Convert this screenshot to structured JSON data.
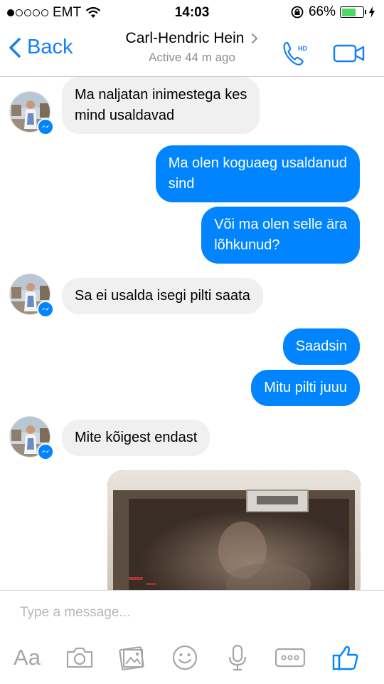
{
  "status_bar": {
    "signal_filled": 1,
    "signal_total": 5,
    "carrier": "EMT",
    "time": "14:03",
    "battery_percent": "66%",
    "battery_level": 0.66,
    "battery_color": "#4cd964"
  },
  "header": {
    "back_label": "Back",
    "contact_name": "Carl-Hendric Hein",
    "status": "Active 44 m ago",
    "icons": [
      "chevron-left-icon",
      "chevron-right-icon",
      "hd-phone-icon",
      "video-camera-icon"
    ]
  },
  "messages": [
    {
      "from": "contact",
      "text": "Ma naljatan inimestega kes\nmind usaldavad"
    },
    {
      "from": "me",
      "text": "Ma olen koguaeg usaldanud\nsind"
    },
    {
      "from": "me",
      "text": "Või ma olen selle ära\nlõhkunud?"
    },
    {
      "from": "contact",
      "text": "Sa ei usalda isegi pilti saata"
    },
    {
      "from": "me",
      "text": "Saadsin"
    },
    {
      "from": "me",
      "text": "Mitu pilti juuu"
    },
    {
      "from": "contact",
      "text": "Mite kõigest endast"
    },
    {
      "from": "me",
      "type": "photo"
    }
  ],
  "composer": {
    "placeholder": "Type a message...",
    "aa_label": "Aa",
    "tools": [
      "text-format-icon",
      "camera-icon",
      "gallery-icon",
      "emoji-icon",
      "microphone-icon",
      "more-icon",
      "like-icon"
    ]
  },
  "colors": {
    "accent": "#0084ff",
    "ios_blue": "#147efb",
    "incoming_bubble": "#f1f0f0",
    "subtle_text": "#8e8e93"
  }
}
